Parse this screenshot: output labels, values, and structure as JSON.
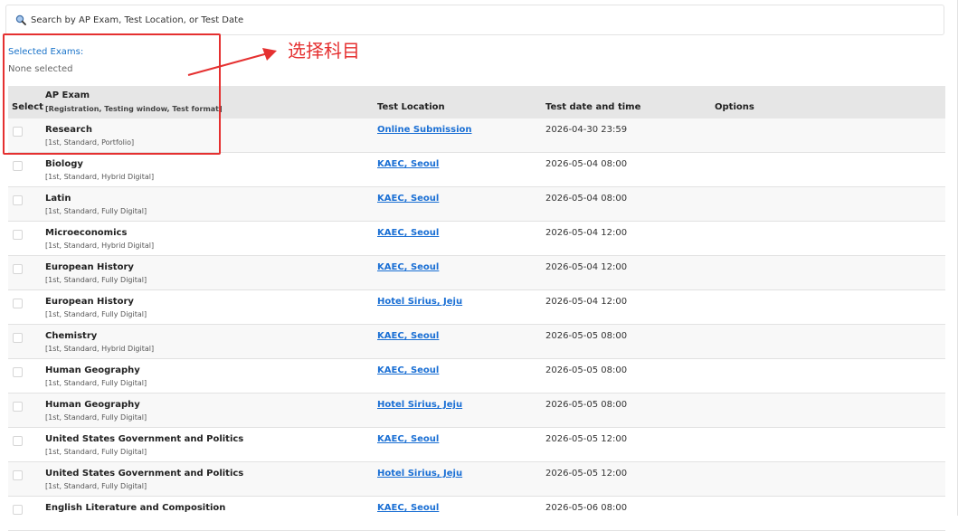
{
  "search": {
    "placeholder": "Search by AP Exam, Test Location, or Test Date",
    "icon": "search-icon"
  },
  "selected": {
    "title": "Selected Exams:",
    "value": "None selected"
  },
  "table": {
    "headers": {
      "select": "Select",
      "exam": "AP Exam",
      "exam_sub": "[Registration, Testing window, Test format]",
      "location": "Test Location",
      "date": "Test date and time",
      "options": "Options"
    },
    "rows": [
      {
        "name": "Research",
        "meta": "[1st, Standard, Portfolio]",
        "location": "Online Submission",
        "datetime": "2026-04-30 23:59"
      },
      {
        "name": "Biology",
        "meta": "[1st, Standard, Hybrid Digital]",
        "location": "KAEC, Seoul",
        "datetime": "2026-05-04 08:00"
      },
      {
        "name": "Latin",
        "meta": "[1st, Standard, Fully Digital]",
        "location": "KAEC, Seoul",
        "datetime": "2026-05-04 08:00"
      },
      {
        "name": "Microeconomics",
        "meta": "[1st, Standard, Hybrid Digital]",
        "location": "KAEC, Seoul",
        "datetime": "2026-05-04 12:00"
      },
      {
        "name": "European History",
        "meta": "[1st, Standard, Fully Digital]",
        "location": "KAEC, Seoul",
        "datetime": "2026-05-04 12:00"
      },
      {
        "name": "European History",
        "meta": "[1st, Standard, Fully Digital]",
        "location": "Hotel Sirius, Jeju",
        "datetime": "2026-05-04 12:00"
      },
      {
        "name": "Chemistry",
        "meta": "[1st, Standard, Hybrid Digital]",
        "location": "KAEC, Seoul",
        "datetime": "2026-05-05 08:00"
      },
      {
        "name": "Human Geography",
        "meta": "[1st, Standard, Fully Digital]",
        "location": "KAEC, Seoul",
        "datetime": "2026-05-05 08:00"
      },
      {
        "name": "Human Geography",
        "meta": "[1st, Standard, Fully Digital]",
        "location": "Hotel Sirius, Jeju",
        "datetime": "2026-05-05 08:00"
      },
      {
        "name": "United States Government and Politics",
        "meta": "[1st, Standard, Fully Digital]",
        "location": "KAEC, Seoul",
        "datetime": "2026-05-05 12:00"
      },
      {
        "name": "United States Government and Politics",
        "meta": "[1st, Standard, Fully Digital]",
        "location": "Hotel Sirius, Jeju",
        "datetime": "2026-05-05 12:00"
      },
      {
        "name": "English Literature and Composition",
        "meta": "",
        "location": "KAEC, Seoul",
        "datetime": "2026-05-06 08:00"
      }
    ]
  },
  "annotation": {
    "text": "选择科目",
    "color": "#e53030"
  },
  "colors": {
    "link": "#1a6fd4",
    "header_bg": "#e6e6e6",
    "accent": "#1a73c9"
  }
}
